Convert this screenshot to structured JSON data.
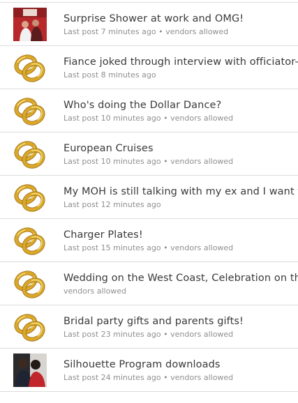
{
  "threads": [
    {
      "title": "Surprise Shower at work and OMG!",
      "last_post": "Last post 7 minutes ago",
      "separator": "•",
      "vendors": "vendors allowed",
      "thumb": "photo-red"
    },
    {
      "title": "Fiance joked through interview with officiator- I'm",
      "last_post": "Last post 8 minutes ago",
      "separator": "",
      "vendors": "",
      "thumb": "rings"
    },
    {
      "title": "Who's doing the Dollar Dance?",
      "last_post": "Last post 10 minutes ago",
      "separator": "•",
      "vendors": "vendors allowed",
      "thumb": "rings"
    },
    {
      "title": "European Cruises",
      "last_post": "Last post 10 minutes ago",
      "separator": "•",
      "vendors": "vendors allowed",
      "thumb": "rings"
    },
    {
      "title": "My MOH is still talking with my ex and I want to de",
      "last_post": "Last post 12 minutes ago",
      "separator": "",
      "vendors": "",
      "thumb": "rings"
    },
    {
      "title": "Charger Plates!",
      "last_post": "Last post 15 minutes ago",
      "separator": "•",
      "vendors": "vendors allowed",
      "thumb": "rings"
    },
    {
      "title": "Wedding on the West Coast, Celebration on the Ea",
      "last_post": "",
      "separator": "",
      "vendors": "vendors allowed",
      "thumb": "rings"
    },
    {
      "title": "Bridal party gifts and parents gifts!",
      "last_post": "Last post 23 minutes ago",
      "separator": "•",
      "vendors": "vendors allowed",
      "thumb": "rings"
    },
    {
      "title": "Silhouette Program downloads",
      "last_post": "Last post 24 minutes ago",
      "separator": "•",
      "vendors": "vendors allowed",
      "thumb": "photo-couple"
    }
  ],
  "icons": {
    "rings": "wedding-rings-icon",
    "photo-red": "user-photo-thumbnail",
    "photo-couple": "user-photo-thumbnail"
  },
  "colors": {
    "title": "#3a3a3a",
    "meta": "#8f8f8f",
    "divider": "#dcdcdc",
    "ring_gold": "#d9a72a",
    "ring_highlight": "#f7e07a",
    "ring_shadow": "#9a6b12"
  }
}
